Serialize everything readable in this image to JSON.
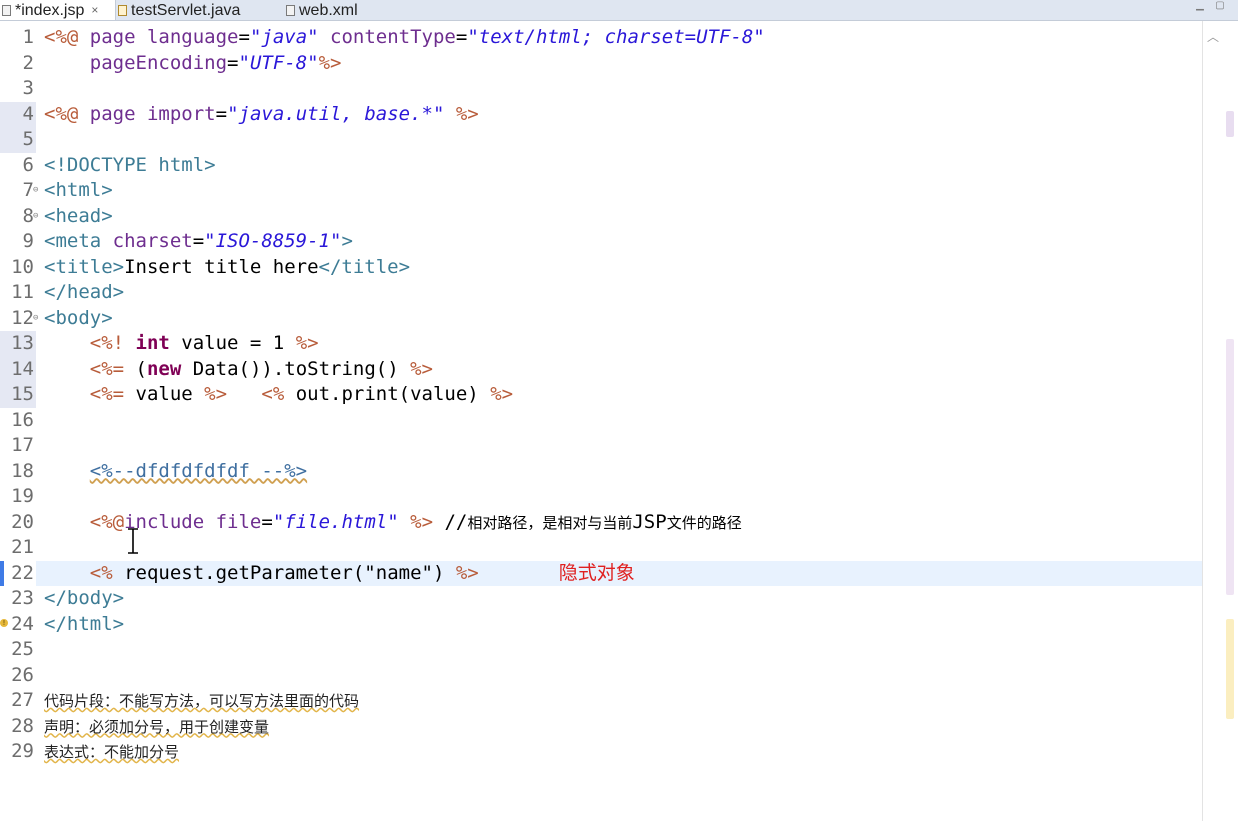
{
  "tabs": [
    {
      "label": "*index.jsp",
      "active": true,
      "close": "×"
    },
    {
      "label": "testServlet.java",
      "active": false
    },
    {
      "label": "web.xml",
      "active": false
    }
  ],
  "lines": [
    {
      "n": "1",
      "t": [
        [
          "delim",
          "<%@ "
        ],
        [
          "attr",
          "page "
        ],
        [
          "attr",
          "language"
        ],
        [
          "plain",
          "="
        ],
        [
          "str",
          "\"java\""
        ],
        [
          "plain",
          " "
        ],
        [
          "attr",
          "contentType"
        ],
        [
          "plain",
          "="
        ],
        [
          "str",
          "\"text/html; charset=UTF-8\""
        ]
      ]
    },
    {
      "n": "2",
      "t": [
        [
          "plain",
          "    "
        ],
        [
          "attr",
          "pageEncoding"
        ],
        [
          "plain",
          "="
        ],
        [
          "str",
          "\"UTF-8\""
        ],
        [
          "delim",
          "%>"
        ]
      ]
    },
    {
      "n": "3",
      "t": []
    },
    {
      "n": "4",
      "t": [
        [
          "delim",
          "<%@ "
        ],
        [
          "attr",
          "page "
        ],
        [
          "attr",
          "import"
        ],
        [
          "plain",
          "="
        ],
        [
          "str",
          "\"java.util, base.*\""
        ],
        [
          "plain",
          " "
        ],
        [
          "delim",
          "%>"
        ]
      ]
    },
    {
      "n": "5",
      "t": []
    },
    {
      "n": "6",
      "t": [
        [
          "tag",
          "<!DOCTYPE html>"
        ]
      ]
    },
    {
      "n": "7",
      "t": [
        [
          "tag",
          "<html>"
        ]
      ]
    },
    {
      "n": "8",
      "t": [
        [
          "tag",
          "<head>"
        ]
      ]
    },
    {
      "n": "9",
      "t": [
        [
          "tag",
          "<meta "
        ],
        [
          "attr",
          "charset"
        ],
        [
          "plain",
          "="
        ],
        [
          "str",
          "\"ISO-8859-1\""
        ],
        [
          "tag",
          ">"
        ]
      ]
    },
    {
      "n": "10",
      "t": [
        [
          "tag",
          "<title>"
        ],
        [
          "plain",
          "Insert title here"
        ],
        [
          "tag",
          "</title>"
        ]
      ]
    },
    {
      "n": "11",
      "t": [
        [
          "tag",
          "</head>"
        ]
      ]
    },
    {
      "n": "12",
      "t": [
        [
          "tag",
          "<body>"
        ]
      ]
    },
    {
      "n": "13",
      "t": [
        [
          "plain",
          "    "
        ],
        [
          "delim",
          "<%! "
        ],
        [
          "kw",
          "int"
        ],
        [
          "plain",
          " value = 1 "
        ],
        [
          "delim",
          "%>"
        ]
      ]
    },
    {
      "n": "14",
      "t": [
        [
          "plain",
          "    "
        ],
        [
          "delim",
          "<%= "
        ],
        [
          "plain",
          "("
        ],
        [
          "kw",
          "new"
        ],
        [
          "plain",
          " Data()).toString() "
        ],
        [
          "delim",
          "%>"
        ]
      ]
    },
    {
      "n": "15",
      "t": [
        [
          "plain",
          "    "
        ],
        [
          "delim",
          "<%= "
        ],
        [
          "plain",
          "value "
        ],
        [
          "delim",
          "%>"
        ],
        [
          "plain",
          "   "
        ],
        [
          "delim",
          "<% "
        ],
        [
          "plain",
          "out.print(value) "
        ],
        [
          "delim",
          "%>"
        ]
      ]
    },
    {
      "n": "16",
      "t": []
    },
    {
      "n": "17",
      "t": []
    },
    {
      "n": "18",
      "t": [
        [
          "plain",
          "    "
        ],
        [
          "comment",
          "<%--dfdfdfdfdf --%>"
        ]
      ]
    },
    {
      "n": "19",
      "t": []
    },
    {
      "n": "20",
      "t": [
        [
          "plain",
          "    "
        ],
        [
          "delim",
          "<%@"
        ],
        [
          "attr",
          "include "
        ],
        [
          "attr",
          "file"
        ],
        [
          "plain",
          "="
        ],
        [
          "str",
          "\"file.html\""
        ],
        [
          "plain",
          " "
        ],
        [
          "delim",
          "%>"
        ],
        [
          "plain",
          " //"
        ],
        [
          "cjk",
          "相对路径，是相对与当前"
        ],
        [
          "plain",
          "JSP"
        ],
        [
          "cjk",
          "文件的路径"
        ]
      ]
    },
    {
      "n": "21",
      "t": []
    },
    {
      "n": "22",
      "t": [
        [
          "plain",
          "    "
        ],
        [
          "delim",
          "<% "
        ],
        [
          "plain",
          "request.getParameter(\"name\") "
        ],
        [
          "delim",
          "%>"
        ],
        [
          "plain",
          "       "
        ],
        [
          "red",
          "隐式对象"
        ]
      ]
    },
    {
      "n": "23",
      "t": [
        [
          "tag",
          "</body>"
        ]
      ]
    },
    {
      "n": "24",
      "t": [
        [
          "tag",
          "</html>"
        ]
      ]
    },
    {
      "n": "25",
      "t": []
    },
    {
      "n": "26",
      "t": []
    },
    {
      "n": "27",
      "t": [
        [
          "note",
          "代码片段：不能写方法，可以写方法里面的代码"
        ]
      ]
    },
    {
      "n": "28",
      "t": [
        [
          "note",
          "声明：必须加分号，用于创建变量"
        ]
      ]
    },
    {
      "n": "29",
      "t": [
        [
          "note",
          "表达式：不能加分号"
        ]
      ]
    }
  ],
  "fold_lines": [
    "7",
    "8",
    "12"
  ],
  "warning_line": "24",
  "current_line": "22",
  "changed_lines": [
    "4",
    "5",
    "13",
    "14",
    "15"
  ],
  "icons": {
    "jsp_file": "jsp-file-icon",
    "java_file": "java-file-icon",
    "xml_file": "xml-file-icon",
    "fold": "fold-collapse-icon",
    "warning": "warning-icon",
    "scroll_up": "scroll-up-icon",
    "text_cursor": "text-cursor-icon"
  },
  "colors": {
    "tag": "#3d7c95",
    "jsp_delimiter": "#b85c3a",
    "attribute": "#6e2e8f",
    "string": "#2a17d8",
    "keyword": "#7f0055",
    "current_line": "#e8f2fe",
    "annotation_red": "#e02020"
  }
}
